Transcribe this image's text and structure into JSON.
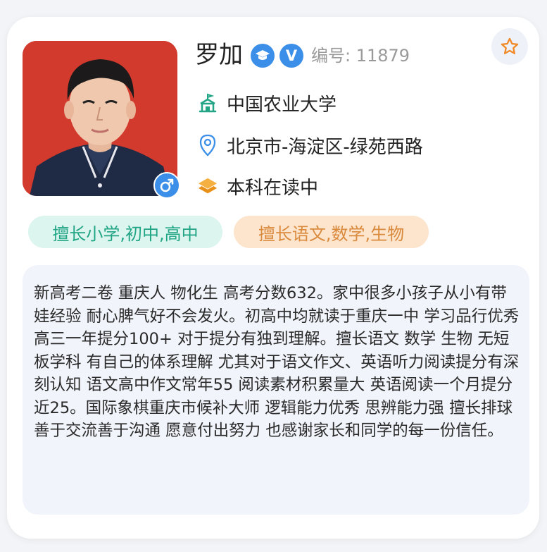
{
  "profile": {
    "name": "罗加",
    "verified_label": "V",
    "serial": "编号: 11879",
    "school": "中国农业大学",
    "location": "北京市-海淀区-绿苑西路",
    "education": "本科在读中"
  },
  "tags": [
    {
      "label": "擅长小学,初中,高中"
    },
    {
      "label": "擅长语文,数学,生物"
    }
  ],
  "description": "新高考二卷 重庆人 物化生 高考分数632。家中很多小孩子从小有带娃经验 耐心脾气好不会发火。初高中均就读于重庆一中 学习品行优秀 高三一年提分100+ 对于提分有独到理解。擅长语文 数学 生物 无短板学科 有自己的体系理解 尤其对于语文作文、英语听力阅读提分有深刻认知 语文高中作文常年55 阅读素材积累量大 英语阅读一个月提分近25。国际象棋重庆市候补大师 逻辑能力优秀 思辨能力强 擅长排球善于交流善于沟通 愿意付出努力 也感谢家长和同学的每一份信任。",
  "icons": {
    "avatar": "person-photo",
    "gender": "male-icon",
    "favorite": "star-outline-icon",
    "graduate": "graduation-cap-icon",
    "school": "school-building-icon",
    "location": "map-pin-icon",
    "education": "layers-icon"
  },
  "colors": {
    "accent_blue": "#3b8fe8",
    "school_green": "#21a585",
    "location_blue": "#3b8fe8",
    "education_orange": "#f0a020",
    "star_orange": "#f08a2a",
    "tag_green_bg": "#dcf5ef",
    "tag_orange_bg": "#fde4cc",
    "desc_bg": "#f1f4fa"
  }
}
